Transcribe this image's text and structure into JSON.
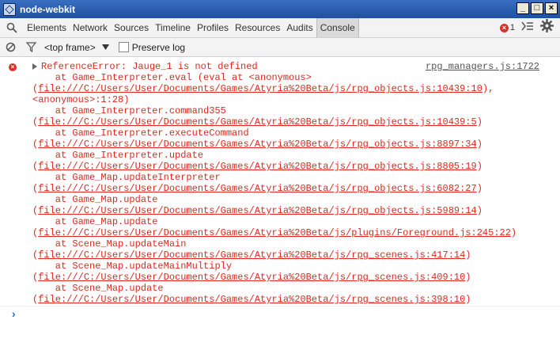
{
  "window": {
    "title": "node-webkit",
    "controls": [
      "_",
      "□",
      "×"
    ]
  },
  "tabs": [
    "Elements",
    "Network",
    "Sources",
    "Timeline",
    "Profiles",
    "Resources",
    "Audits",
    "Console"
  ],
  "active_tab": "Console",
  "error_count": "1",
  "toolbar": {
    "frame_label": "<top frame>",
    "preserve_log_label": "Preserve log"
  },
  "console": {
    "source_link": "rpg_managers.js:1722",
    "lines": [
      {
        "text": "ReferenceError: Jauge_1 is not defined",
        "indent": false
      },
      {
        "text": "    at Game_Interpreter.eval (eval at <anonymous>",
        "indent": false
      },
      {
        "pre": "(",
        "url": "file:///C:/Users/User/Documents/Games/Atyria%20Beta/js/rpg_objects.js:10439:10",
        "post": "),"
      },
      {
        "text": "<anonymous>:1:28)",
        "indent": false
      },
      {
        "text": "    at Game_Interpreter.command355",
        "indent": false
      },
      {
        "pre": "(",
        "url": "file:///C:/Users/User/Documents/Games/Atyria%20Beta/js/rpg_objects.js:10439:5",
        "post": ")"
      },
      {
        "text": "    at Game_Interpreter.executeCommand",
        "indent": false
      },
      {
        "pre": "(",
        "url": "file:///C:/Users/User/Documents/Games/Atyria%20Beta/js/rpg_objects.js:8897:34",
        "post": ")"
      },
      {
        "text": "    at Game_Interpreter.update",
        "indent": false
      },
      {
        "pre": "(",
        "url": "file:///C:/Users/User/Documents/Games/Atyria%20Beta/js/rpg_objects.js:8805:19",
        "post": ")"
      },
      {
        "text": "    at Game_Map.updateInterpreter",
        "indent": false
      },
      {
        "pre": "(",
        "url": "file:///C:/Users/User/Documents/Games/Atyria%20Beta/js/rpg_objects.js:6082:27",
        "post": ")"
      },
      {
        "text": "    at Game_Map.update",
        "indent": false
      },
      {
        "pre": "(",
        "url": "file:///C:/Users/User/Documents/Games/Atyria%20Beta/js/rpg_objects.js:5989:14",
        "post": ")"
      },
      {
        "text": "    at Game_Map.update",
        "indent": false
      },
      {
        "pre": "(",
        "url": "file:///C:/Users/User/Documents/Games/Atyria%20Beta/js/plugins/Foreground.js:245:22",
        "post": ")"
      },
      {
        "text": "    at Scene_Map.updateMain",
        "indent": false
      },
      {
        "pre": "(",
        "url": "file:///C:/Users/User/Documents/Games/Atyria%20Beta/js/rpg_scenes.js:417:14",
        "post": ")"
      },
      {
        "text": "    at Scene_Map.updateMainMultiply",
        "indent": false
      },
      {
        "pre": "(",
        "url": "file:///C:/Users/User/Documents/Games/Atyria%20Beta/js/rpg_scenes.js:409:10",
        "post": ")"
      },
      {
        "text": "    at Scene_Map.update",
        "indent": false
      },
      {
        "pre": "(",
        "url": "file:///C:/Users/User/Documents/Games/Atyria%20Beta/js/rpg_scenes.js:398:10",
        "post": ")"
      }
    ],
    "prompt": "›"
  },
  "colors": {
    "error_text": "#e0271f",
    "title_bar": "#1f4fa0",
    "prompt": "#2a6ad8"
  }
}
